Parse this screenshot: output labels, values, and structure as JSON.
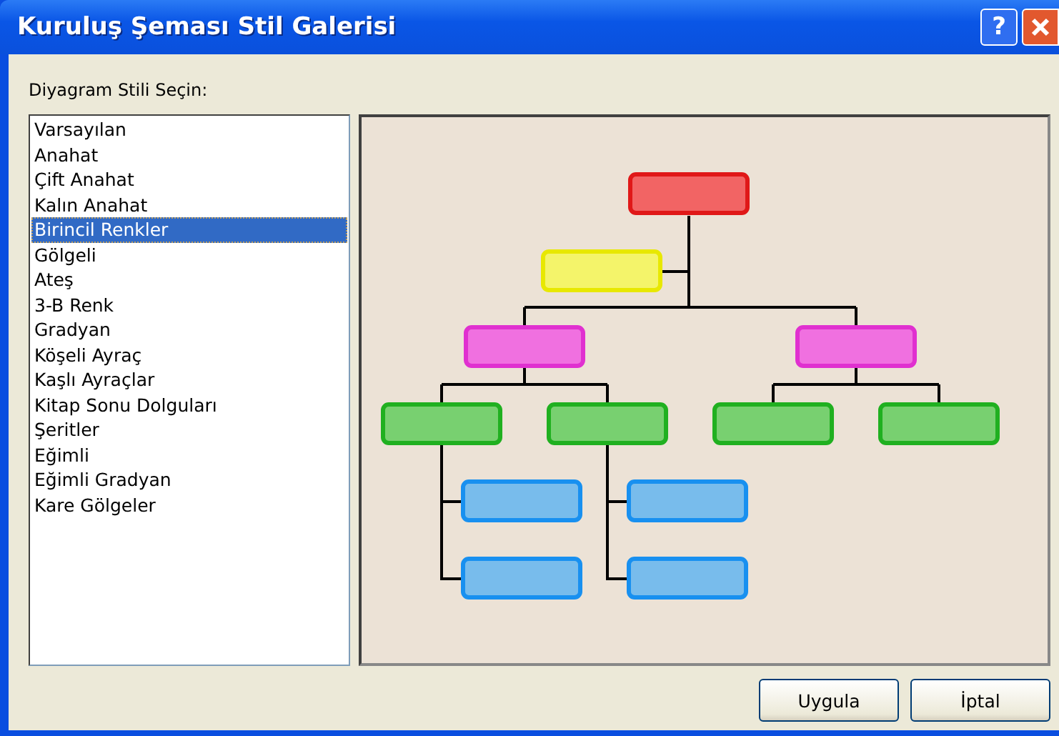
{
  "window": {
    "title": "Kuruluş Şeması Stil Galerisi",
    "buttons": [
      "?"
    ]
  },
  "list_label": "Diyagram Stili Seçin:",
  "styles": [
    {
      "label": "Varsayılan",
      "selected": false
    },
    {
      "label": "Anahat",
      "selected": false
    },
    {
      "label": "Çift Anahat",
      "selected": false
    },
    {
      "label": "Kalın Anahat",
      "selected": false
    },
    {
      "label": "Birincil Renkler",
      "selected": true
    },
    {
      "label": "Gölgeli",
      "selected": false
    },
    {
      "label": "Ateş",
      "selected": false
    },
    {
      "label": "3-B Renk",
      "selected": false
    },
    {
      "label": "Gradyan",
      "selected": false
    },
    {
      "label": "Köşeli Ayraç",
      "selected": false
    },
    {
      "label": "Kaşlı Ayraçlar",
      "selected": false
    },
    {
      "label": "Kitap Sonu Dolguları",
      "selected": false
    },
    {
      "label": "Şeritler",
      "selected": false
    },
    {
      "label": "Eğimli",
      "selected": false
    },
    {
      "label": "Eğimli Gradyan",
      "selected": false
    },
    {
      "label": "Kare Gölgeler",
      "selected": false
    }
  ],
  "buttons": [
    "Uygula",
    "İptal"
  ]
}
